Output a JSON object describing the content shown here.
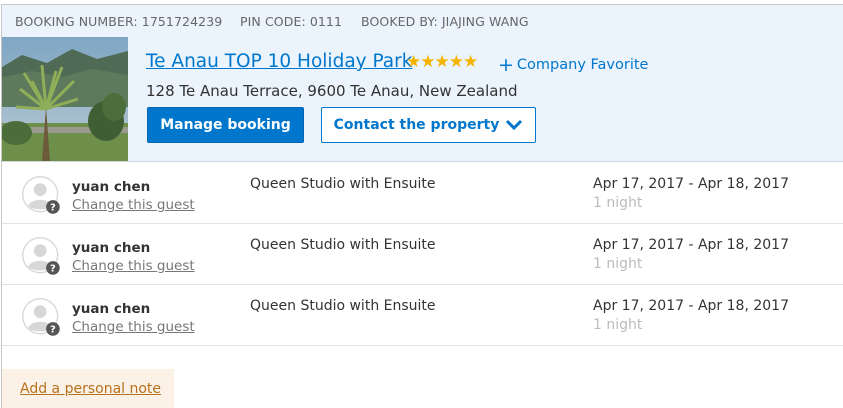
{
  "booking": {
    "number_label": "BOOKING NUMBER: 1751724239",
    "pin_label": "PIN CODE: 0111",
    "booked_by_label": "BOOKED BY: JIAJING WANG"
  },
  "hotel": {
    "name": "Te Anau TOP 10 Holiday Park",
    "stars": "★★★★★",
    "star_rating": 5,
    "favorite_label": "Company Favorite",
    "favorite_icon": "plus-icon",
    "address": "128 Te Anau Terrace, 9600 Te Anau, New Zealand",
    "photo_icon": "hotel-photo"
  },
  "actions": {
    "manage_label": "Manage booking",
    "contact_label": "Contact the property",
    "contact_icon": "chevron-down-icon"
  },
  "guests": [
    {
      "name": "yuan chen",
      "change_label": "Change this guest",
      "room": "Queen Studio with Ensuite",
      "dates": "Apr 17, 2017 - Apr 18, 2017",
      "nights": "1 night"
    },
    {
      "name": "yuan chen",
      "change_label": "Change this guest",
      "room": "Queen Studio with Ensuite",
      "dates": "Apr 17, 2017 - Apr 18, 2017",
      "nights": "1 night"
    },
    {
      "name": "yuan chen",
      "change_label": "Change this guest",
      "room": "Queen Studio with Ensuite",
      "dates": "Apr 17, 2017 - Apr 18, 2017",
      "nights": "1 night"
    }
  ],
  "note": {
    "label": "Add a personal note"
  },
  "colors": {
    "accent": "#0077cc",
    "header_bg": "#ebf3fd",
    "star": "#f5b400",
    "note_bg": "#fcf1e6",
    "note_link": "#b5721c"
  }
}
